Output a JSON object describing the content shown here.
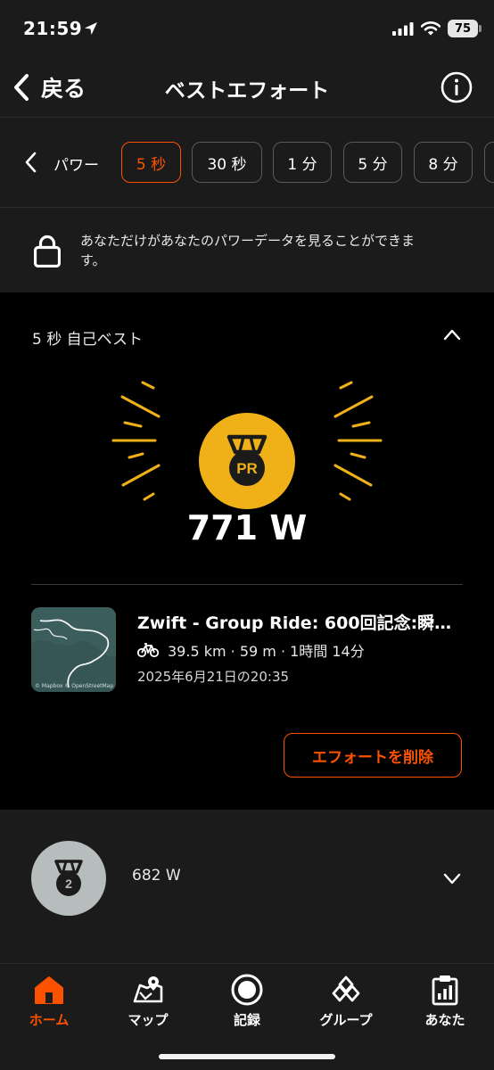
{
  "status_bar": {
    "time": "21:59",
    "battery": "75"
  },
  "nav": {
    "back_label": "戻る",
    "title": "ベストエフォート"
  },
  "chips": {
    "category_label": "パワー",
    "items": [
      {
        "label": "5 秒",
        "active": true
      },
      {
        "label": "30 秒",
        "active": false
      },
      {
        "label": "1 分",
        "active": false
      },
      {
        "label": "5 分",
        "active": false
      },
      {
        "label": "8 分",
        "active": false
      }
    ]
  },
  "privacy": {
    "text": "あなただけがあなたのパワーデータを見ることができます。"
  },
  "best": {
    "heading": "5 秒 自己ベスト",
    "medal_text": "PR",
    "value": "771 W",
    "activity": {
      "title": "Zwift - Group Ride: 600回記念:瞬…",
      "stats": "39.5 km · 59 m · 1時間 14分",
      "date": "2025年6月21日の20:35",
      "map_attribution": "© Mapbox © OpenStreetMap"
    },
    "delete_label": "エフォートを削除"
  },
  "second": {
    "rank": "2",
    "value": "682 W"
  },
  "tabs": [
    {
      "label": "ホーム",
      "icon": "home-icon",
      "active": true
    },
    {
      "label": "マップ",
      "icon": "map-icon",
      "active": false
    },
    {
      "label": "記録",
      "icon": "record-icon",
      "active": false
    },
    {
      "label": "グループ",
      "icon": "groups-icon",
      "active": false
    },
    {
      "label": "あなた",
      "icon": "you-icon",
      "active": false
    }
  ],
  "colors": {
    "accent": "#fc5200",
    "gold": "#f0b118",
    "silver": "#b7bcbc",
    "background": "#1b1b1c"
  }
}
